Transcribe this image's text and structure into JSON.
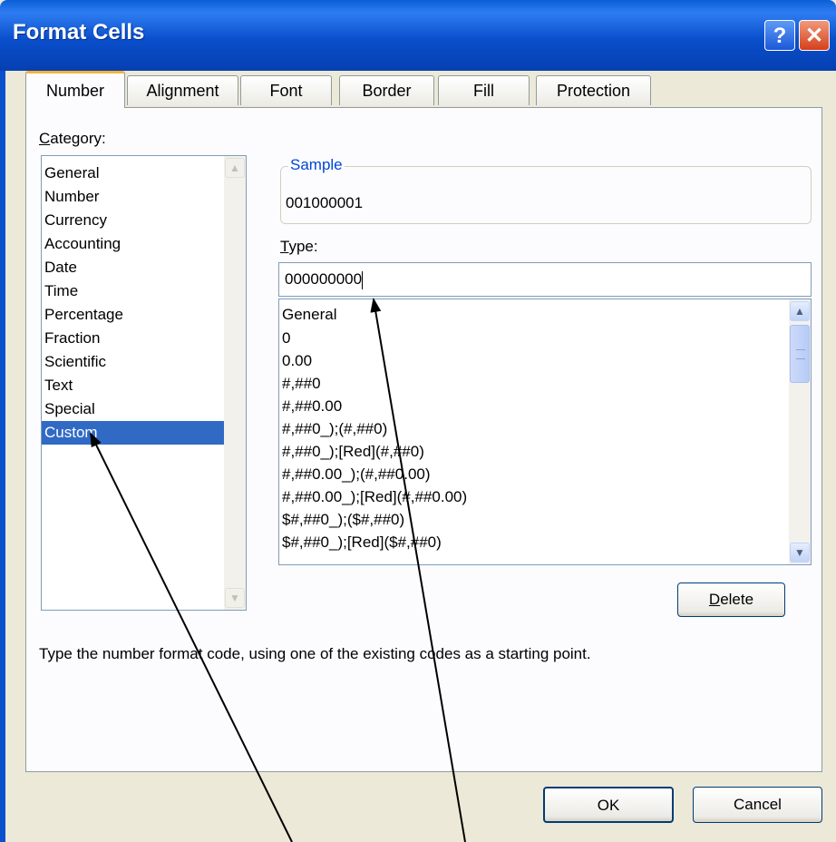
{
  "window": {
    "title": "Format Cells",
    "help_label": "?",
    "close_label": "✕"
  },
  "tabs": [
    {
      "label": "Number",
      "active": true
    },
    {
      "label": "Alignment"
    },
    {
      "label": "Font"
    },
    {
      "label": "Border"
    },
    {
      "label": "Fill"
    },
    {
      "label": "Protection"
    }
  ],
  "category": {
    "label_first": "C",
    "label_rest": "ategory:",
    "items": [
      "General",
      "Number",
      "Currency",
      "Accounting",
      "Date",
      "Time",
      "Percentage",
      "Fraction",
      "Scientific",
      "Text",
      "Special",
      "Custom"
    ],
    "selected": "Custom"
  },
  "sample": {
    "legend": "Sample",
    "value": "001000001"
  },
  "type": {
    "label_first": "T",
    "label_rest": "ype:",
    "value": "000000000",
    "formats": [
      "General",
      "0",
      "0.00",
      "#,##0",
      "#,##0.00",
      "#,##0_);(#,##0)",
      "#,##0_);[Red](#,##0)",
      "#,##0.00_);(#,##0.00)",
      "#,##0.00_);[Red](#,##0.00)",
      "$#,##0_);($#,##0)",
      "$#,##0_);[Red]($#,##0)"
    ]
  },
  "delete_button": {
    "label_first": "D",
    "label_rest": "elete"
  },
  "hint": "Type the number format code, using one of the existing codes as a starting point.",
  "footer": {
    "ok_label": "OK",
    "cancel_label": "Cancel"
  },
  "icons": {
    "scroll_up": "chevron-up-icon",
    "scroll_down": "chevron-down-icon"
  },
  "colors": {
    "titlebar": "#0a4fcc",
    "selection": "#316ac5",
    "tab_highlight": "#f7b23a",
    "sample_legend": "#0046d5"
  }
}
